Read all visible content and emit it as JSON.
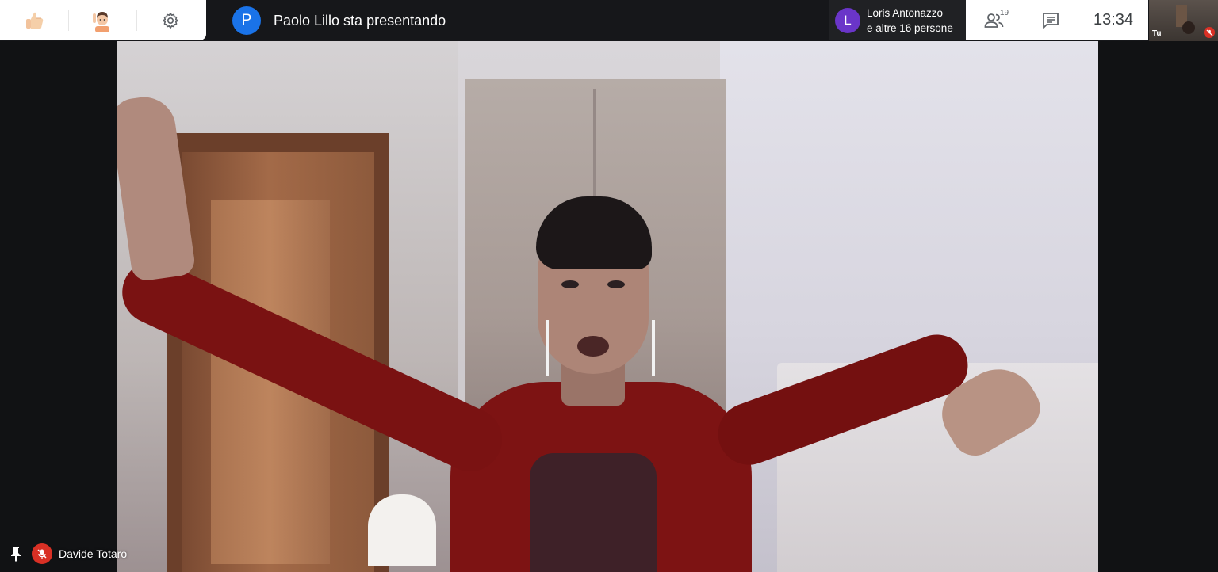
{
  "toolbar_left": {
    "reactions": [
      "thumbs-up-icon",
      "raise-hand-icon",
      "settings-icon"
    ]
  },
  "presentation": {
    "presenter_initial": "P",
    "presenter_text": "Paolo Lillo sta presentando",
    "presenter_color": "#1a73e8"
  },
  "speaker": {
    "initial": "L",
    "line1": "Loris Antonazzo",
    "line2": "e altre 16 persone",
    "color": "#6a35c9"
  },
  "toolbar_right": {
    "participants_count": "19",
    "clock": "13:34"
  },
  "self_tile": {
    "label": "Tu"
  },
  "main_video": {
    "participant_name": "Davide Totaro",
    "muted": true
  },
  "colors": {
    "mute_red": "#d93025",
    "bar_bg": "#16171a"
  }
}
